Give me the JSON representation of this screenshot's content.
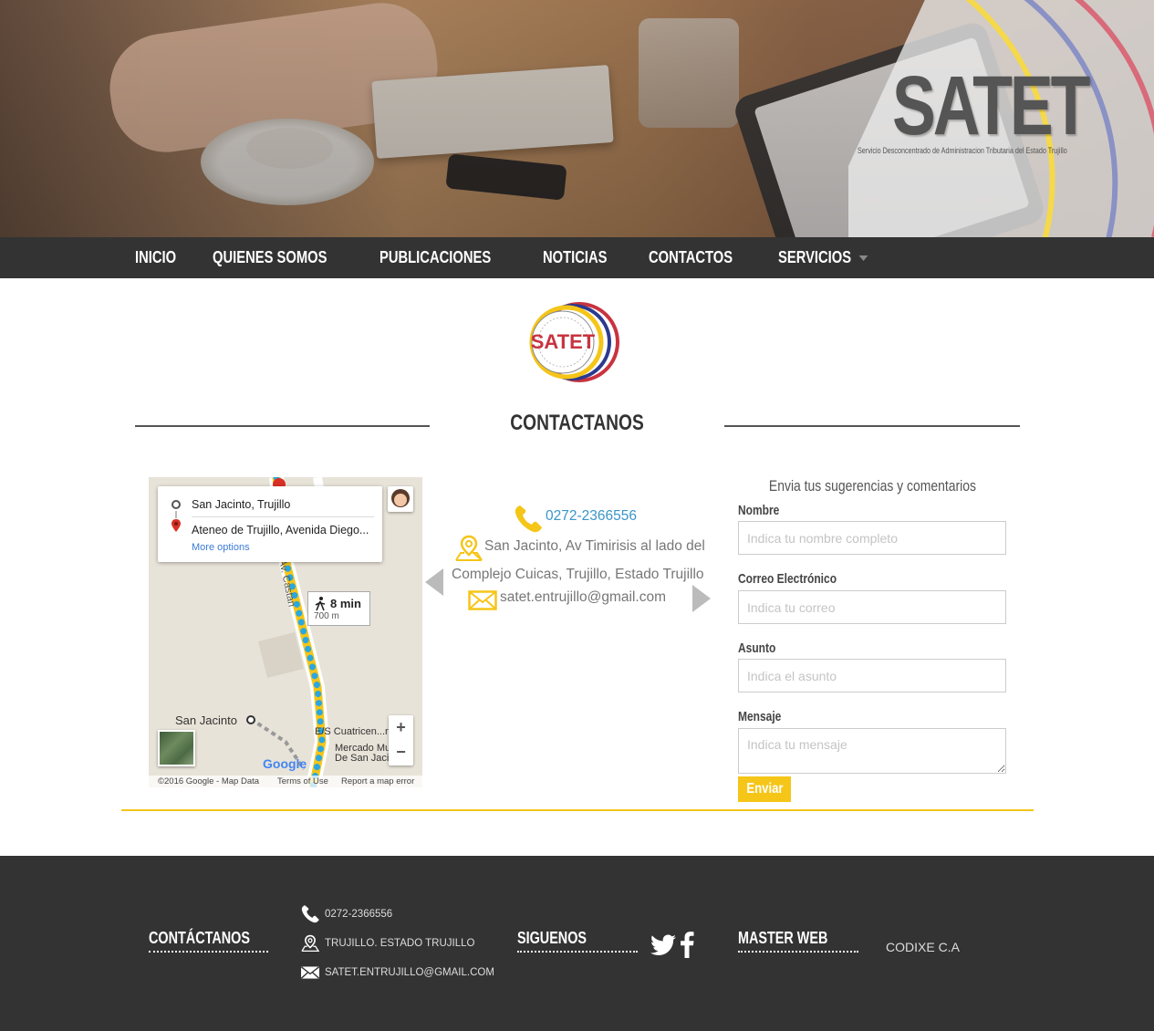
{
  "hero": {
    "brand": "SATET",
    "subtitle": "Servicio Desconcentrado de Administracion Tributaria del Estado Trujillo"
  },
  "nav": {
    "items": [
      "INICIO",
      "QUIENES SOMOS",
      "PUBLICACIONES",
      "NOTICIAS",
      "CONTACTOS",
      "SERVICIOS"
    ]
  },
  "logo": {
    "text": "SATET"
  },
  "section": {
    "title": "CONTACTANOS"
  },
  "map": {
    "origin": "San Jacinto, Trujillo",
    "destination": "Ateneo de Trujillo, Avenida Diego...",
    "more_options": "More options",
    "walk_time": "8 min",
    "walk_distance": "700 m",
    "street": "Av. Castan",
    "place_san_jacinto": "San Jacinto",
    "place_gas": "E/S Cuatricen...ria",
    "place_market_1": "Mercado Mu...al",
    "place_market_2": "De San Jaci...",
    "zoom_in": "+",
    "zoom_out": "−",
    "google": "Google",
    "copyright": "©2016 Google - Map Data",
    "terms": "Terms of Use",
    "report": "Report a map error"
  },
  "contact": {
    "phone": "0272-2366556",
    "address_line1": "San Jacinto, Av Timirisis al lado del",
    "address_line2": "Complejo Cuicas, Trujillo, Estado Trujillo",
    "email": "satet.entrujillo@gmail.com"
  },
  "form": {
    "title": "Envia tus sugerencias y comentarios",
    "name_label": "Nombre",
    "name_placeholder": "Indica tu nombre completo",
    "email_label": "Correo Electrónico",
    "email_placeholder": "Indica tu correo",
    "subject_label": "Asunto",
    "subject_placeholder": "Indica el asunto",
    "message_label": "Mensaje",
    "message_placeholder": "Indica tu mensaje",
    "submit": "Enviar"
  },
  "footer": {
    "contact_heading": "CONTÁCTANOS",
    "phone": "0272-2366556",
    "address": "TRUJILLO. ESTADO TRUJILLO",
    "email": "SATET.ENTRUJILLO@GMAIL.COM",
    "follow_heading": "SIGUENOS",
    "master_heading": "MASTER WEB",
    "master_name": "CODIXE C.A"
  },
  "colors": {
    "nav_bg": "#333333",
    "accent_yellow": "#f5c518",
    "link_blue": "#3a95c9",
    "footer_bg": "#333333"
  }
}
